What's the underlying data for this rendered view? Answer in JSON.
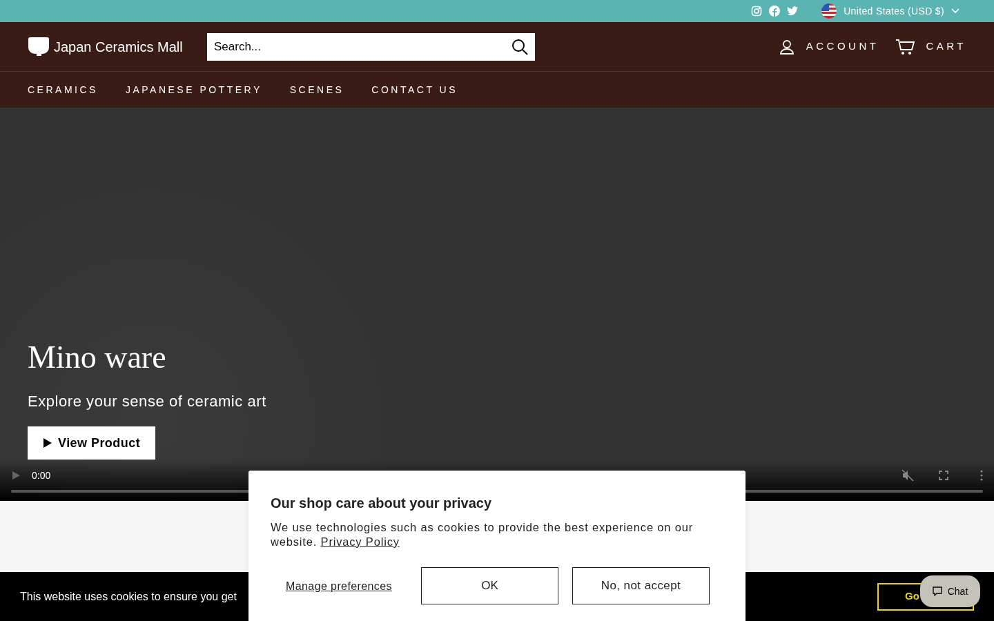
{
  "topbar": {
    "country": "United States (USD $)"
  },
  "header": {
    "logo": "Japan Ceramics Mall",
    "search": {
      "placeholder": "Search..."
    },
    "account": "ACCOUNT",
    "cart": "CART"
  },
  "nav": [
    "CERAMICS",
    "JAPANESE POTTERY",
    "SCENES",
    "CONTACT US"
  ],
  "hero": {
    "title": "Mino ware",
    "subtitle": "Explore your sense of ceramic art",
    "button": "View Product",
    "time": "0:00"
  },
  "privacy_dialog": {
    "title": "Our shop care about your privacy",
    "text": "We use technologies such as cookies to provide the best experience on our website.",
    "link": "Privacy Policy",
    "manage": "Manage preferences",
    "ok": "OK",
    "decline": "No, not accept"
  },
  "cookie_bar": {
    "text": "This website uses cookies to ensure you get",
    "button": "Go"
  },
  "chat": {
    "label": "Chat"
  }
}
